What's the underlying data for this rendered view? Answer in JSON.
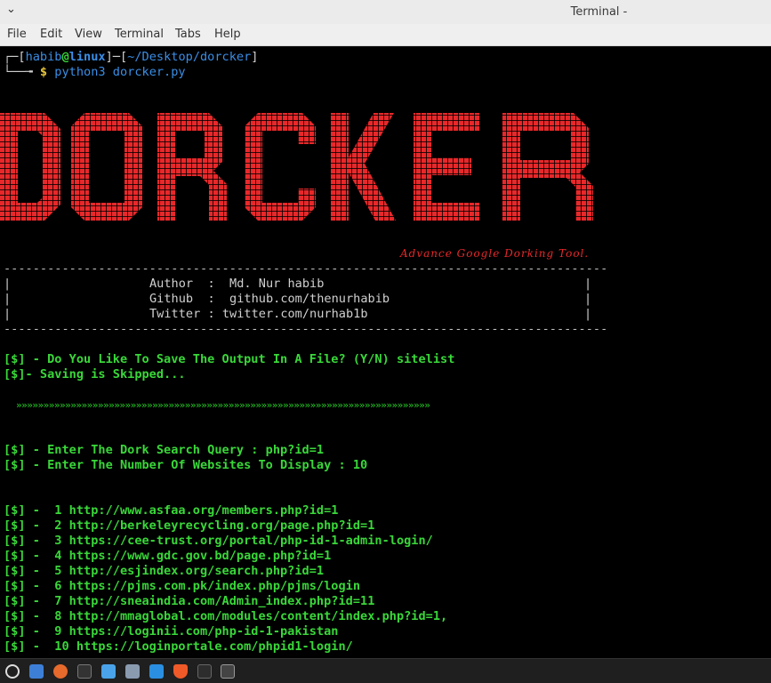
{
  "window": {
    "title": "Terminal -",
    "chevron": "⌄"
  },
  "menu": [
    "File",
    "Edit",
    "View",
    "Terminal",
    "Tabs",
    "Help"
  ],
  "prompt": {
    "line1_open": "┌─[",
    "user": "habib",
    "at": "@",
    "host": "linux",
    "mid": "]─[",
    "path": "~/Desktop/dorcker",
    "close": "]",
    "line2_prefix": "└──╼ ",
    "dollar": "$",
    "command": "python3 dorcker.py"
  },
  "banner": {
    "logo_text": "DORCKER",
    "logo_color": "#e8282a",
    "tagline": "Advance Google Dorking Tool."
  },
  "info_box": {
    "separator": "-----------------------------------------------------------------------------------",
    "author_line": "Author  :  Md. Nur habib",
    "github_line": "Github  :  github.com/thenurhabib",
    "twitter_line": "Twitter : twitter.com/nurhab1b",
    "bar": "|"
  },
  "save_prompt": "[$] - Do You Like To Save The Output In A File? (Y/N) sitelist",
  "save_skipped": "[$]- Saving is Skipped...",
  "arrows": "»»»»»»»»»»»»»»»»»»»»»»»»»»»»»»»»»»»»»»»»»»»»»»»»»»»»»»»»»»»»»»»»»»»»»»»»»»»»",
  "query_prompt": "[$] - Enter The Dork Search Query : php?id=1",
  "count_prompt": "[$] - Enter The Number Of Websites To Display : 10",
  "results": [
    "[$] -  1 http://www.asfaa.org/members.php?id=1",
    "[$] -  2 http://berkeleyrecycling.org/page.php?id=1",
    "[$] -  3 https://cee-trust.org/portal/php-id-1-admin-login/",
    "[$] -  4 https://www.gdc.gov.bd/page.php?id=1",
    "[$] -  5 http://esjindex.org/search.php?id=1",
    "[$] -  6 https://pjms.com.pk/index.php/pjms/login",
    "[$] -  7 http://sneaindia.com/Admin_index.php?id=11",
    "[$] -  8 http://mmaglobal.com/modules/content/index.php?id=1,",
    "[$] -  9 https://loginii.com/php-id-1-pakistan",
    "[$] -  10 https://loginportale.com/phpid1-login/"
  ],
  "taskbar_icons": [
    "menu-icon",
    "files-icon",
    "firefox-icon",
    "terminal-icon",
    "finder-icon",
    "folder-icon",
    "vscode-icon",
    "brave-icon",
    "terminal2-icon",
    "terminal3-icon"
  ]
}
